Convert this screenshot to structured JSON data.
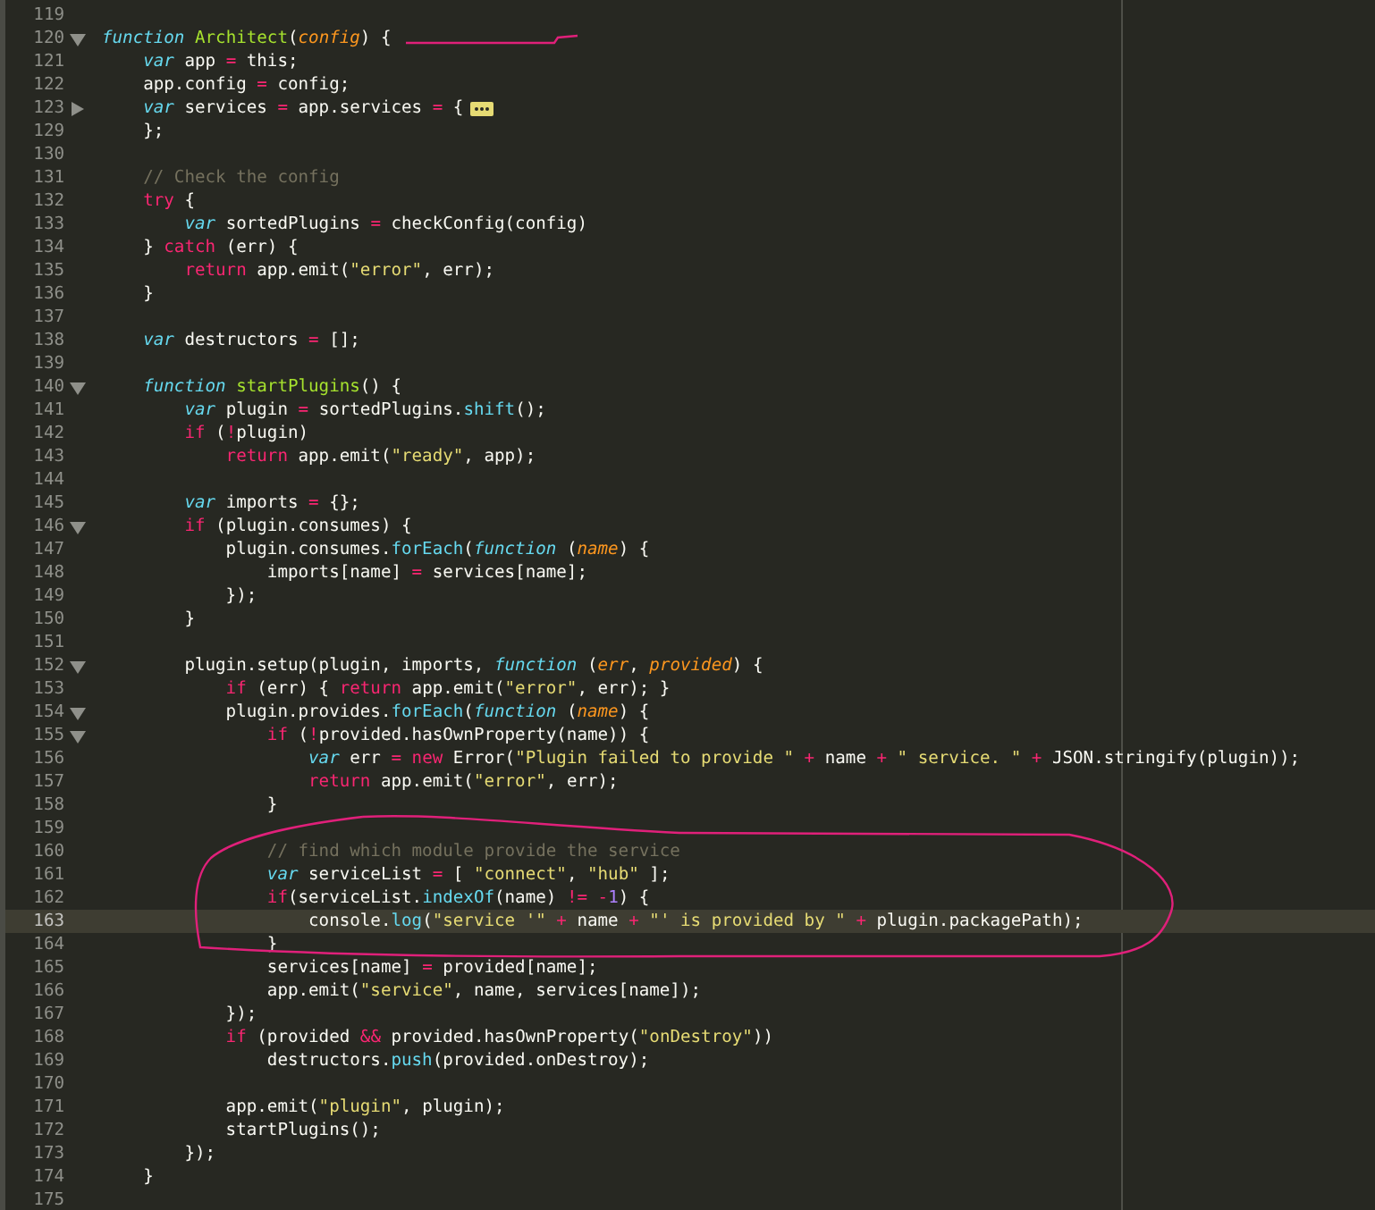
{
  "editor": {
    "lines": [
      {
        "number": "119",
        "current": false
      },
      {
        "number": "120",
        "current": false,
        "folded": false,
        "code": [
          {
            "kind": "storage",
            "text": "function"
          },
          {
            "kind": "entity",
            "text": " Architect"
          },
          {
            "kind": "plain",
            "text": "("
          },
          {
            "kind": "parameter",
            "text": "config"
          },
          {
            "kind": "plain",
            "text": ") {"
          }
        ]
      },
      {
        "number": "121",
        "current": false,
        "code": [
          {
            "kind": "storage",
            "text": "    var"
          },
          {
            "kind": "plain",
            "text": " app "
          },
          {
            "kind": "keyword",
            "text": "="
          },
          {
            "kind": "plain",
            "text": " this;"
          }
        ]
      },
      {
        "number": "122",
        "current": false,
        "code": [
          {
            "kind": "plain",
            "text": "    app.config "
          },
          {
            "kind": "keyword",
            "text": "="
          },
          {
            "kind": "plain",
            "text": " config;"
          }
        ]
      },
      {
        "number": "123",
        "current": false,
        "folded": true,
        "code": [
          {
            "kind": "storage",
            "text": "    var"
          },
          {
            "kind": "plain",
            "text": " services "
          },
          {
            "kind": "keyword",
            "text": "="
          },
          {
            "kind": "plain",
            "text": " app.services "
          },
          {
            "kind": "keyword",
            "text": "="
          },
          {
            "kind": "plain",
            "text": " {"
          }
        ]
      },
      {
        "number": "129",
        "current": false,
        "code": [
          {
            "kind": "plain",
            "text": "    };"
          }
        ]
      },
      {
        "number": "130",
        "current": false
      },
      {
        "number": "131",
        "current": false,
        "code": [
          {
            "kind": "comment",
            "text": "    // Check the config"
          }
        ]
      },
      {
        "number": "132",
        "current": false,
        "code": [
          {
            "kind": "keyword",
            "text": "    try"
          },
          {
            "kind": "plain",
            "text": " {"
          }
        ]
      },
      {
        "number": "133",
        "current": false,
        "code": [
          {
            "kind": "storage",
            "text": "        var"
          },
          {
            "kind": "plain",
            "text": " sortedPlugins "
          },
          {
            "kind": "keyword",
            "text": "="
          },
          {
            "kind": "plain",
            "text": " checkConfig(config)"
          }
        ]
      },
      {
        "number": "134",
        "current": false,
        "code": [
          {
            "kind": "plain",
            "text": "    } "
          },
          {
            "kind": "keyword",
            "text": "catch"
          },
          {
            "kind": "plain",
            "text": " (err) {"
          }
        ]
      },
      {
        "number": "135",
        "current": false,
        "code": [
          {
            "kind": "keyword",
            "text": "        return"
          },
          {
            "kind": "plain",
            "text": " app.emit("
          },
          {
            "kind": "string",
            "text": "\"error\""
          },
          {
            "kind": "plain",
            "text": ", err);"
          }
        ]
      },
      {
        "number": "136",
        "current": false,
        "code": [
          {
            "kind": "plain",
            "text": "    }"
          }
        ]
      },
      {
        "number": "137",
        "current": false
      },
      {
        "number": "138",
        "current": false,
        "code": [
          {
            "kind": "storage",
            "text": "    var"
          },
          {
            "kind": "plain",
            "text": " destructors "
          },
          {
            "kind": "keyword",
            "text": "="
          },
          {
            "kind": "plain",
            "text": " [];"
          }
        ]
      },
      {
        "number": "139",
        "current": false
      },
      {
        "number": "140",
        "current": false,
        "folded": false,
        "code": [
          {
            "kind": "storage",
            "text": "    function"
          },
          {
            "kind": "entity",
            "text": " startPlugins"
          },
          {
            "kind": "plain",
            "text": "() {"
          }
        ]
      },
      {
        "number": "141",
        "current": false,
        "code": [
          {
            "kind": "storage",
            "text": "        var"
          },
          {
            "kind": "plain",
            "text": " plugin "
          },
          {
            "kind": "keyword",
            "text": "="
          },
          {
            "kind": "plain",
            "text": " sortedPlugins."
          },
          {
            "kind": "support",
            "text": "shift"
          },
          {
            "kind": "plain",
            "text": "();"
          }
        ]
      },
      {
        "number": "142",
        "current": false,
        "code": [
          {
            "kind": "keyword",
            "text": "        if"
          },
          {
            "kind": "plain",
            "text": " ("
          },
          {
            "kind": "keyword",
            "text": "!"
          },
          {
            "kind": "plain",
            "text": "plugin)"
          }
        ]
      },
      {
        "number": "143",
        "current": false,
        "code": [
          {
            "kind": "keyword",
            "text": "            return"
          },
          {
            "kind": "plain",
            "text": " app.emit("
          },
          {
            "kind": "string",
            "text": "\"ready\""
          },
          {
            "kind": "plain",
            "text": ", app);"
          }
        ]
      },
      {
        "number": "144",
        "current": false
      },
      {
        "number": "145",
        "current": false,
        "code": [
          {
            "kind": "storage",
            "text": "        var"
          },
          {
            "kind": "plain",
            "text": " imports "
          },
          {
            "kind": "keyword",
            "text": "="
          },
          {
            "kind": "plain",
            "text": " {};"
          }
        ]
      },
      {
        "number": "146",
        "current": false,
        "folded": false,
        "code": [
          {
            "kind": "keyword",
            "text": "        if"
          },
          {
            "kind": "plain",
            "text": " (plugin.consumes) {"
          }
        ]
      },
      {
        "number": "147",
        "current": false,
        "code": [
          {
            "kind": "plain",
            "text": "            plugin.consumes."
          },
          {
            "kind": "support",
            "text": "forEach"
          },
          {
            "kind": "plain",
            "text": "("
          },
          {
            "kind": "storage",
            "text": "function"
          },
          {
            "kind": "plain",
            "text": " ("
          },
          {
            "kind": "parameter",
            "text": "name"
          },
          {
            "kind": "plain",
            "text": ") {"
          }
        ]
      },
      {
        "number": "148",
        "current": false,
        "code": [
          {
            "kind": "plain",
            "text": "                imports[name] "
          },
          {
            "kind": "keyword",
            "text": "="
          },
          {
            "kind": "plain",
            "text": " services[name];"
          }
        ]
      },
      {
        "number": "149",
        "current": false,
        "code": [
          {
            "kind": "plain",
            "text": "            });"
          }
        ]
      },
      {
        "number": "150",
        "current": false,
        "code": [
          {
            "kind": "plain",
            "text": "        }"
          }
        ]
      },
      {
        "number": "151",
        "current": false
      },
      {
        "number": "152",
        "current": false,
        "folded": false,
        "code": [
          {
            "kind": "plain",
            "text": "        plugin.setup(plugin, imports, "
          },
          {
            "kind": "storage",
            "text": "function"
          },
          {
            "kind": "plain",
            "text": " ("
          },
          {
            "kind": "parameter",
            "text": "err"
          },
          {
            "kind": "plain",
            "text": ", "
          },
          {
            "kind": "parameter",
            "text": "provided"
          },
          {
            "kind": "plain",
            "text": ") {"
          }
        ]
      },
      {
        "number": "153",
        "current": false,
        "code": [
          {
            "kind": "keyword",
            "text": "            if"
          },
          {
            "kind": "plain",
            "text": " (err) { "
          },
          {
            "kind": "keyword",
            "text": "return"
          },
          {
            "kind": "plain",
            "text": " app.emit("
          },
          {
            "kind": "string",
            "text": "\"error\""
          },
          {
            "kind": "plain",
            "text": ", err); }"
          }
        ]
      },
      {
        "number": "154",
        "current": false,
        "folded": false,
        "code": [
          {
            "kind": "plain",
            "text": "            plugin.provides."
          },
          {
            "kind": "support",
            "text": "forEach"
          },
          {
            "kind": "plain",
            "text": "("
          },
          {
            "kind": "storage",
            "text": "function"
          },
          {
            "kind": "plain",
            "text": " ("
          },
          {
            "kind": "parameter",
            "text": "name"
          },
          {
            "kind": "plain",
            "text": ") {"
          }
        ]
      },
      {
        "number": "155",
        "current": false,
        "folded": false,
        "code": [
          {
            "kind": "keyword",
            "text": "                if"
          },
          {
            "kind": "plain",
            "text": " ("
          },
          {
            "kind": "keyword",
            "text": "!"
          },
          {
            "kind": "plain",
            "text": "provided.hasOwnProperty(name)) {"
          }
        ]
      },
      {
        "number": "156",
        "current": false,
        "code": [
          {
            "kind": "storage",
            "text": "                    var"
          },
          {
            "kind": "plain",
            "text": " err "
          },
          {
            "kind": "keyword",
            "text": "="
          },
          {
            "kind": "keyword",
            "text": " new"
          },
          {
            "kind": "plain",
            "text": " Error("
          },
          {
            "kind": "string",
            "text": "\"Plugin failed to provide \""
          },
          {
            "kind": "keyword",
            "text": " +"
          },
          {
            "kind": "plain",
            "text": " name "
          },
          {
            "kind": "keyword",
            "text": "+"
          },
          {
            "kind": "string",
            "text": " \" service. \""
          },
          {
            "kind": "keyword",
            "text": " +"
          },
          {
            "kind": "plain",
            "text": " JSON.stringify(plugin));"
          }
        ]
      },
      {
        "number": "157",
        "current": false,
        "code": [
          {
            "kind": "keyword",
            "text": "                    return"
          },
          {
            "kind": "plain",
            "text": " app.emit("
          },
          {
            "kind": "string",
            "text": "\"error\""
          },
          {
            "kind": "plain",
            "text": ", err);"
          }
        ]
      },
      {
        "number": "158",
        "current": false,
        "code": [
          {
            "kind": "plain",
            "text": "                }"
          }
        ]
      },
      {
        "number": "159",
        "current": false
      },
      {
        "number": "160",
        "current": false,
        "code": [
          {
            "kind": "comment",
            "text": "                // find which module provide the service"
          }
        ]
      },
      {
        "number": "161",
        "current": false,
        "code": [
          {
            "kind": "storage",
            "text": "                var"
          },
          {
            "kind": "plain",
            "text": " serviceList "
          },
          {
            "kind": "keyword",
            "text": "="
          },
          {
            "kind": "plain",
            "text": " [ "
          },
          {
            "kind": "string",
            "text": "\"connect\""
          },
          {
            "kind": "plain",
            "text": ", "
          },
          {
            "kind": "string",
            "text": "\"hub\""
          },
          {
            "kind": "plain",
            "text": " ];"
          }
        ]
      },
      {
        "number": "162",
        "current": false,
        "code": [
          {
            "kind": "keyword",
            "text": "                if"
          },
          {
            "kind": "plain",
            "text": "(serviceList."
          },
          {
            "kind": "support",
            "text": "indexOf"
          },
          {
            "kind": "plain",
            "text": "(name) "
          },
          {
            "kind": "keyword",
            "text": "!="
          },
          {
            "kind": "keyword",
            "text": " -"
          },
          {
            "kind": "number",
            "text": "1"
          },
          {
            "kind": "plain",
            "text": ") {"
          }
        ]
      },
      {
        "number": "163",
        "current": true,
        "code": [
          {
            "kind": "plain",
            "text": "                    console."
          },
          {
            "kind": "support",
            "text": "log"
          },
          {
            "kind": "plain",
            "text": "("
          },
          {
            "kind": "string",
            "text": "\"service '\""
          },
          {
            "kind": "keyword",
            "text": " +"
          },
          {
            "kind": "plain",
            "text": " name "
          },
          {
            "kind": "keyword",
            "text": "+"
          },
          {
            "kind": "string",
            "text": " \"' is provided by \""
          },
          {
            "kind": "keyword",
            "text": " +"
          },
          {
            "kind": "plain",
            "text": " plugin.packagePath);"
          }
        ]
      },
      {
        "number": "164",
        "current": false,
        "code": [
          {
            "kind": "plain",
            "text": "                }"
          }
        ]
      },
      {
        "number": "165",
        "current": false,
        "code": [
          {
            "kind": "plain",
            "text": "                services[name] "
          },
          {
            "kind": "keyword",
            "text": "="
          },
          {
            "kind": "plain",
            "text": " provided[name];"
          }
        ]
      },
      {
        "number": "166",
        "current": false,
        "code": [
          {
            "kind": "plain",
            "text": "                app.emit("
          },
          {
            "kind": "string",
            "text": "\"service\""
          },
          {
            "kind": "plain",
            "text": ", name, services[name]);"
          }
        ]
      },
      {
        "number": "167",
        "current": false,
        "code": [
          {
            "kind": "plain",
            "text": "            });"
          }
        ]
      },
      {
        "number": "168",
        "current": false,
        "code": [
          {
            "kind": "keyword",
            "text": "            if"
          },
          {
            "kind": "plain",
            "text": " (provided "
          },
          {
            "kind": "keyword",
            "text": "&&"
          },
          {
            "kind": "plain",
            "text": " provided.hasOwnProperty("
          },
          {
            "kind": "string",
            "text": "\"onDestroy\""
          },
          {
            "kind": "plain",
            "text": "))"
          }
        ]
      },
      {
        "number": "169",
        "current": false,
        "code": [
          {
            "kind": "plain",
            "text": "                destructors."
          },
          {
            "kind": "support",
            "text": "push"
          },
          {
            "kind": "plain",
            "text": "(provided.onDestroy);"
          }
        ]
      },
      {
        "number": "170",
        "current": false
      },
      {
        "number": "171",
        "current": false,
        "code": [
          {
            "kind": "plain",
            "text": "            app.emit("
          },
          {
            "kind": "string",
            "text": "\"plugin\""
          },
          {
            "kind": "plain",
            "text": ", plugin);"
          }
        ]
      },
      {
        "number": "172",
        "current": false,
        "code": [
          {
            "kind": "plain",
            "text": "            startPlugins();"
          }
        ]
      },
      {
        "number": "173",
        "current": false,
        "code": [
          {
            "kind": "plain",
            "text": "        });"
          }
        ]
      },
      {
        "number": "174",
        "current": false,
        "code": [
          {
            "kind": "plain",
            "text": "    }"
          }
        ]
      },
      {
        "number": "175",
        "current": false
      }
    ]
  }
}
